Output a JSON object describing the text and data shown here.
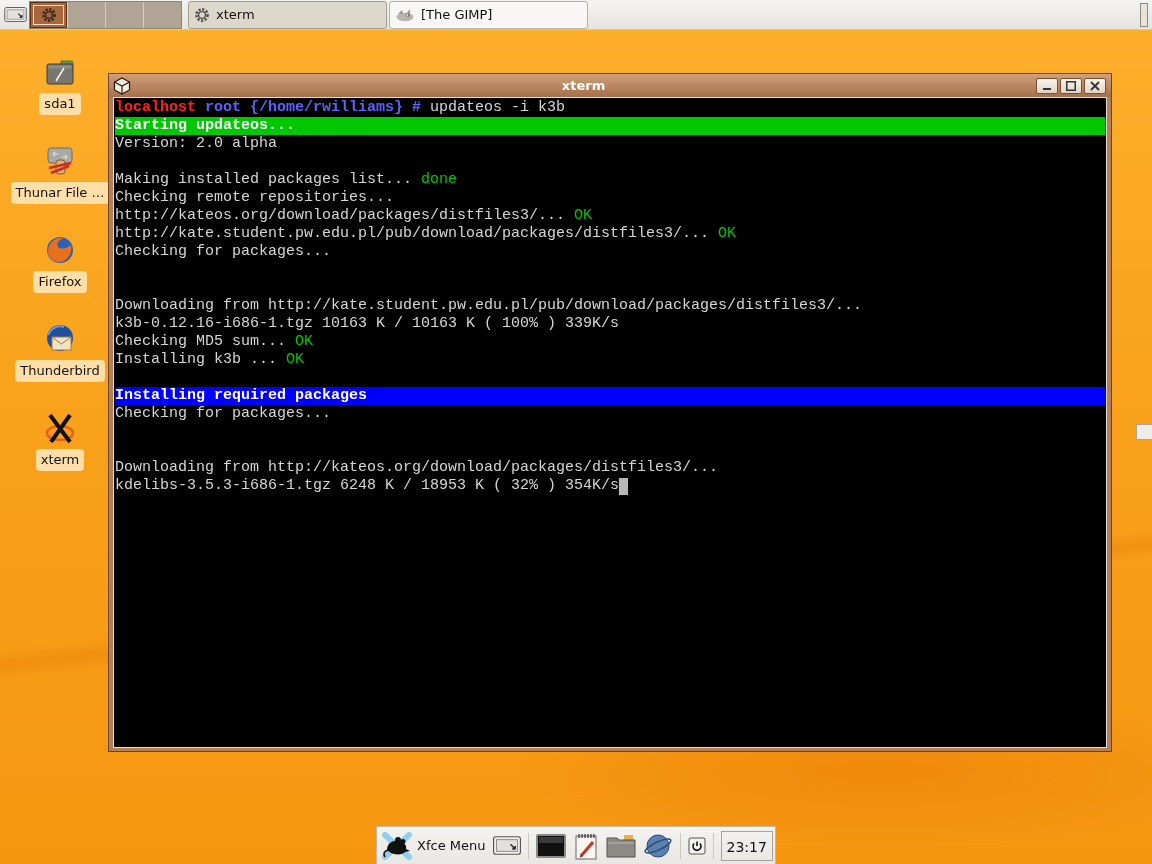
{
  "top_panel": {
    "workspaces": [
      {
        "selected": true,
        "occupied": true
      },
      {
        "selected": false,
        "occupied": false
      },
      {
        "selected": false,
        "occupied": false
      },
      {
        "selected": false,
        "occupied": false
      }
    ],
    "tasks": [
      {
        "label": "xterm",
        "kind": "terminal",
        "selected": true
      },
      {
        "label": "[The GIMP]",
        "kind": "gimp",
        "selected": false
      }
    ]
  },
  "desktop_icons": [
    {
      "label": "sda1",
      "kind": "drive"
    },
    {
      "label": "Thunar File …",
      "kind": "file-manager"
    },
    {
      "label": "Firefox",
      "kind": "browser"
    },
    {
      "label": "Thunderbird",
      "kind": "mail"
    },
    {
      "label": "xterm",
      "kind": "terminal"
    }
  ],
  "window": {
    "title": "xterm",
    "lines": [
      {
        "kind": "text",
        "segments": [
          {
            "kind": "host",
            "text": "localhost"
          },
          {
            "kind": "prompt",
            "text": "root {/home/rwilliams} #"
          },
          {
            "kind": "plain",
            "text": "updateos -i k3b"
          }
        ]
      },
      {
        "kind": "banner",
        "color": "#00c800",
        "text": "Starting updateos..."
      },
      {
        "kind": "text",
        "segments": [
          {
            "kind": "plain",
            "text": "Version: 2.0 alpha"
          }
        ]
      },
      {
        "kind": "blank"
      },
      {
        "kind": "text",
        "segments": [
          {
            "kind": "plain",
            "text": "Making installed packages list..."
          },
          {
            "kind": "status",
            "text": "done"
          }
        ]
      },
      {
        "kind": "text",
        "segments": [
          {
            "kind": "plain",
            "text": "Checking remote repositories..."
          }
        ]
      },
      {
        "kind": "text",
        "segments": [
          {
            "kind": "plain",
            "text": "http://kateos.org/download/packages/distfiles3/..."
          },
          {
            "kind": "status",
            "text": "OK"
          }
        ]
      },
      {
        "kind": "text",
        "segments": [
          {
            "kind": "plain",
            "text": "http://kate.student.pw.edu.pl/pub/download/packages/distfiles3/..."
          },
          {
            "kind": "status",
            "text": "OK"
          }
        ]
      },
      {
        "kind": "text",
        "segments": [
          {
            "kind": "plain",
            "text": "Checking for packages..."
          }
        ]
      },
      {
        "kind": "blank"
      },
      {
        "kind": "blank"
      },
      {
        "kind": "text",
        "segments": [
          {
            "kind": "plain",
            "text": "Downloading from http://kate.student.pw.edu.pl/pub/download/packages/distfiles3/..."
          }
        ]
      },
      {
        "kind": "text",
        "segments": [
          {
            "kind": "plain",
            "text": "k3b-0.12.16-i686-1.tgz 10163 K / 10163 K ( 100% ) 339K/s"
          }
        ]
      },
      {
        "kind": "text",
        "segments": [
          {
            "kind": "plain",
            "text": "Checking MD5 sum..."
          },
          {
            "kind": "status",
            "text": "OK"
          }
        ]
      },
      {
        "kind": "text",
        "segments": [
          {
            "kind": "plain",
            "text": "Installing k3b ..."
          },
          {
            "kind": "status",
            "text": "OK"
          }
        ]
      },
      {
        "kind": "blank"
      },
      {
        "kind": "banner",
        "color": "#0000ff",
        "text": "Installing required packages"
      },
      {
        "kind": "text",
        "segments": [
          {
            "kind": "plain",
            "text": "Checking for packages..."
          }
        ]
      },
      {
        "kind": "blank"
      },
      {
        "kind": "blank"
      },
      {
        "kind": "text",
        "segments": [
          {
            "kind": "plain",
            "text": "Downloading from http://kateos.org/download/packages/distfiles3/..."
          }
        ]
      },
      {
        "kind": "text",
        "cursor": true,
        "segments": [
          {
            "kind": "plain",
            "text": "kdelibs-3.5.3-i686-1.tgz 6248 K / 18953 K ( 32% ) 354K/s"
          }
        ]
      }
    ]
  },
  "bottom_panel": {
    "menu_label": "Xfce Menu",
    "clock": "23:17"
  }
}
